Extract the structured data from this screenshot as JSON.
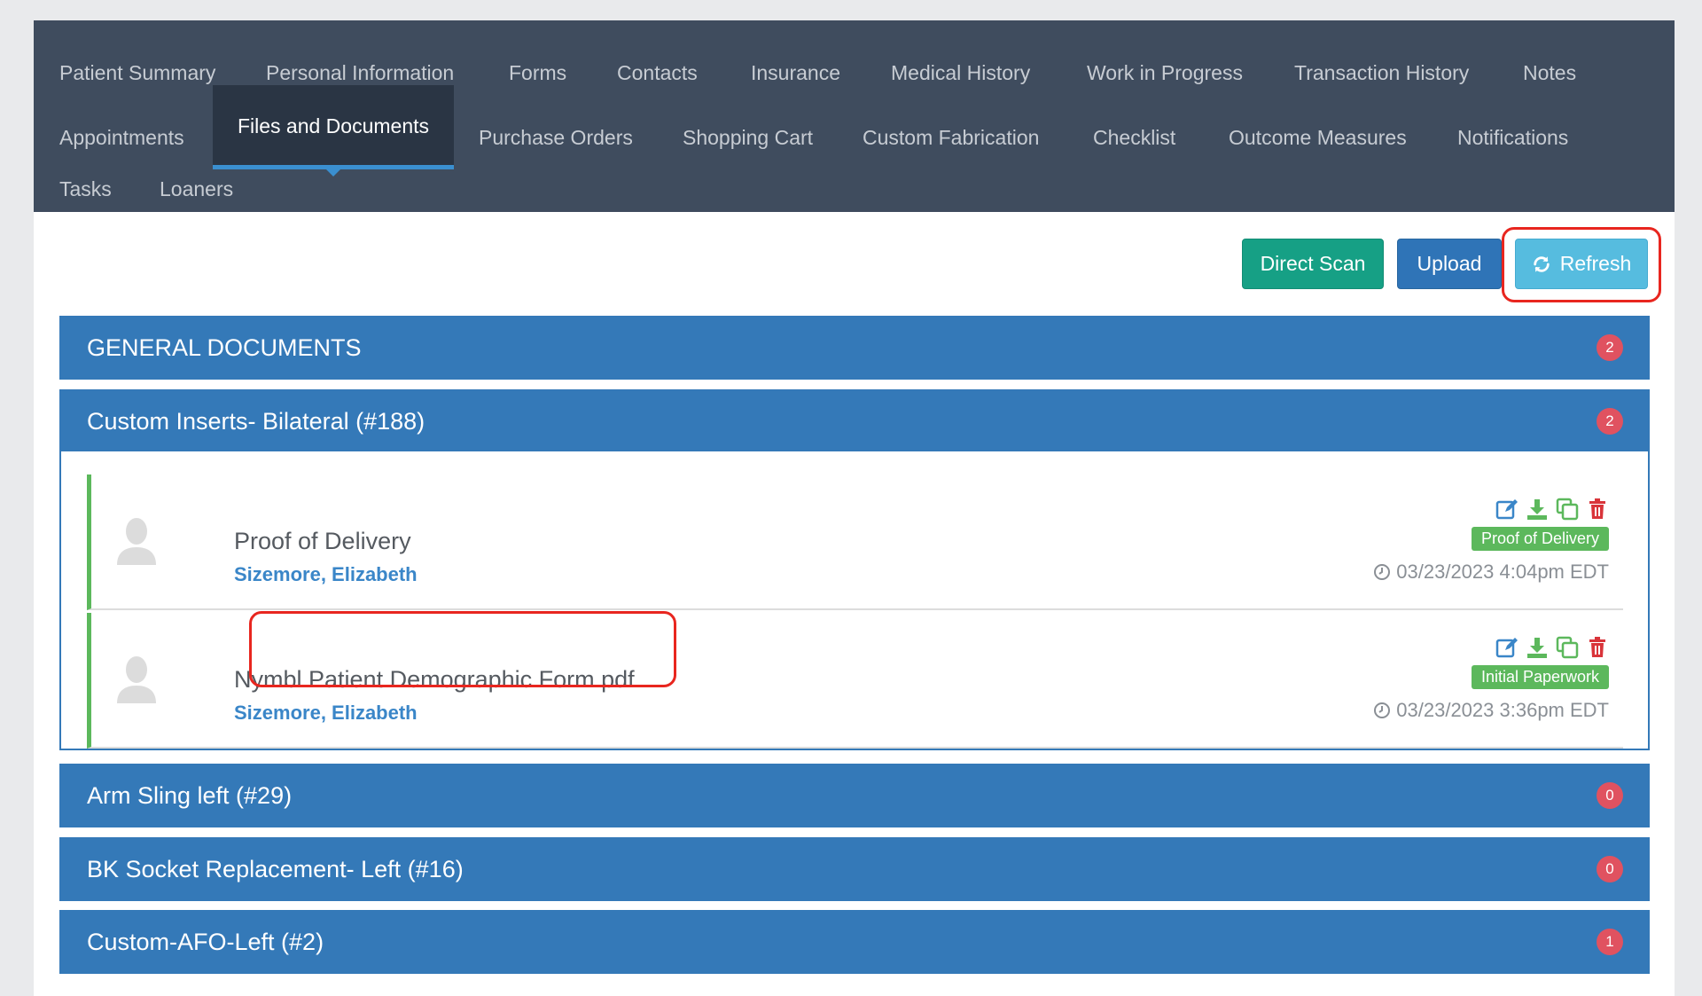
{
  "tabs": {
    "row1": [
      "Patient Summary",
      "Personal Information",
      "Forms",
      "Contacts",
      "Insurance",
      "Medical History",
      "Work in Progress",
      "Transaction History",
      "Notes"
    ],
    "row2": [
      "Appointments",
      "Files and Documents",
      "Purchase Orders",
      "Shopping Cart",
      "Custom Fabrication",
      "Checklist",
      "Outcome Measures",
      "Notifications"
    ],
    "row3": [
      "Tasks",
      "Loaners"
    ]
  },
  "actions": {
    "direct_scan": "Direct Scan",
    "upload": "Upload",
    "refresh": "Refresh",
    "refresh_icon": "refresh-icon"
  },
  "panels": [
    {
      "title": "GENERAL DOCUMENTS",
      "count": "2"
    },
    {
      "title": "Custom Inserts- Bilateral (#188)",
      "count": "2"
    },
    {
      "title": "Arm Sling left (#29)",
      "count": "0"
    },
    {
      "title": "BK Socket Replacement- Left (#16)",
      "count": "0"
    },
    {
      "title": "Custom-AFO-Left (#2)",
      "count": "1"
    }
  ],
  "documents": [
    {
      "title": "Proof of Delivery",
      "user": "Sizemore, Elizabeth",
      "tag": "Proof of Delivery",
      "date": "03/23/2023 4:04pm EDT"
    },
    {
      "title": "Nymbl Patient Demographic Form.pdf",
      "user": "Sizemore, Elizabeth",
      "tag": "Initial Paperwork",
      "date": "03/23/2023 3:36pm EDT"
    }
  ],
  "colors": {
    "tabbar": "#3f4c5e",
    "panel": "#3479b8",
    "badge": "#e05260",
    "success": "#5cb85c",
    "scan": "#16a085",
    "upload": "#2f74b7",
    "refresh": "#56bcdf",
    "highlight": "#e8261f"
  }
}
